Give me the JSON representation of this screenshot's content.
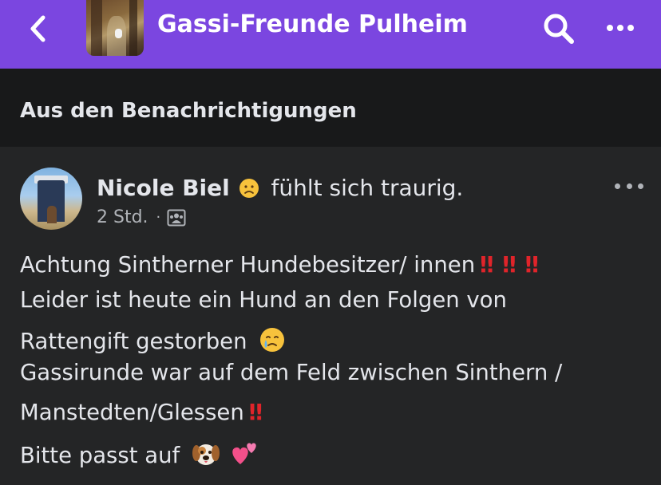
{
  "header": {
    "back_icon": "chevron-left-icon",
    "group_name": "Gassi-Freunde Pulheim",
    "search_icon": "search-icon",
    "more_icon": "more-horizontal-icon",
    "background_color": "#7b46e0"
  },
  "notifications_section": {
    "title": "Aus den Benachrichtigungen"
  },
  "post": {
    "author": "Nicole Biel",
    "feeling_emoji": "sad-face-emoji",
    "feeling_text": "fühlt sich traurig.",
    "time": "2 Std.",
    "separator": "·",
    "audience_icon": "group-members-icon",
    "more_icon": "more-horizontal-icon",
    "lines": [
      {
        "text": "Achtung Sintherner Hundebesitzer/ innen",
        "suffix": [
          "‼",
          "‼",
          "‼"
        ]
      },
      {
        "text": "Leider ist heute ein Hund an den Folgen von"
      },
      {
        "text": "Rattengift gestorben",
        "emoji": "crying-face-emoji"
      },
      {
        "text": "Gassirunde war auf dem Feld zwischen Sinthern /"
      },
      {
        "text": "Manstedten/Glessen",
        "suffix": [
          "‼"
        ]
      },
      {
        "text": "Bitte passt auf",
        "emoji": [
          "dog-face-emoji",
          "two-hearts-emoji"
        ]
      }
    ]
  }
}
